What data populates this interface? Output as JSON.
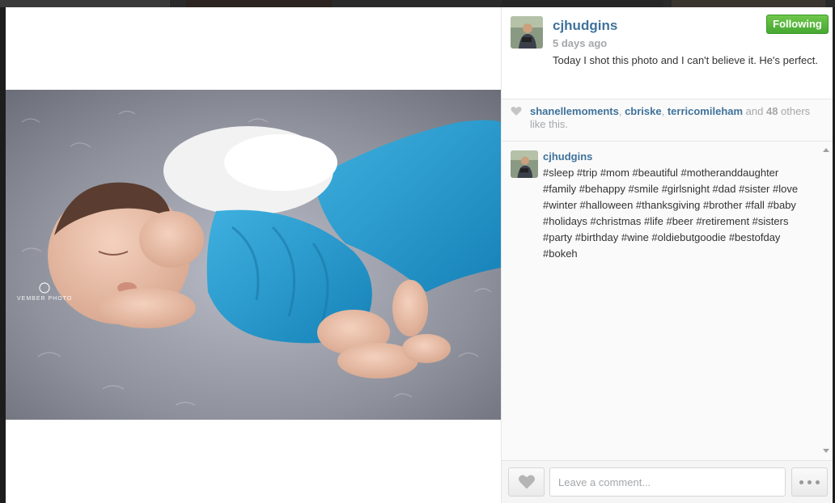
{
  "post": {
    "username": "cjhudgins",
    "time_ago": "5 days ago",
    "caption": "Today I shot this photo and I can't believe it. He's perfect.",
    "follow_label": "Following",
    "photo_watermark": "VEMBER PHOTO"
  },
  "likes": {
    "users": [
      "shanellemoments",
      "cbriske",
      "terricomileham"
    ],
    "sep1": ", ",
    "sep2": ", ",
    "and_text": " and ",
    "others_count": "48",
    "others_text": " others like this."
  },
  "comments": [
    {
      "username": "cjhudgins",
      "text": "#sleep #trip #mom #beautiful #motheranddaughter #family #behappy #smile #girlsnight #dad #sister #love #winter #halloween #thanksgiving #brother #fall #baby #holidays #christmas #life #beer #retirement #sisters #party #birthday #wine #oldiebutgoodie #bestofday #bokeh"
    }
  ],
  "comment_bar": {
    "placeholder": "Leave a comment..."
  },
  "icons": {
    "heart": "heart-icon",
    "more": "more-options-icon",
    "scroll_up": "scroll-up-arrow-icon",
    "scroll_down": "scroll-down-arrow-icon"
  },
  "colors": {
    "link": "#3f729b",
    "follow": "#4cae35",
    "meta": "#a5a7aa"
  }
}
